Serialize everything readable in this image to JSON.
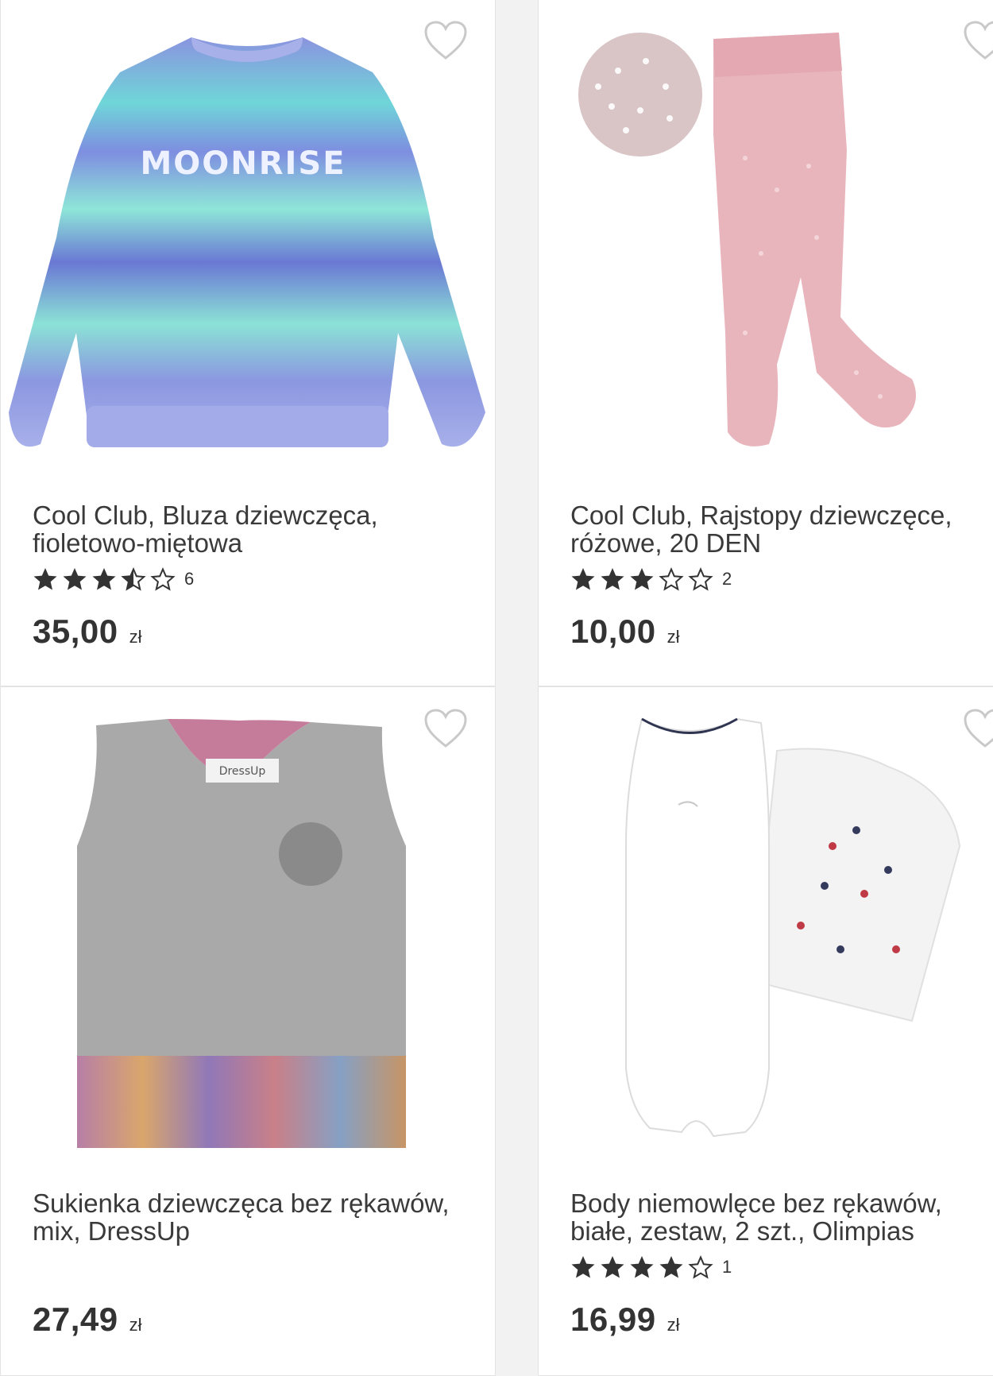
{
  "products": [
    {
      "title_line1": "Cool Club, Bluza dziewczęca,",
      "title_line2": "fioletowo-miętowa",
      "stars": 3.5,
      "rating_count": "6",
      "price": "35,00",
      "currency": "zł",
      "image_print": "MOONRISE"
    },
    {
      "title_line1": "Cool Club, Rajstopy dziewczęce,",
      "title_line2": "różowe, 20 DEN",
      "stars": 3,
      "rating_count": "2",
      "price": "10,00",
      "currency": "zł"
    },
    {
      "title_line1": "Sukienka dziewczęca bez rękawów,",
      "title_line2": "mix, DressUp",
      "price": "27,49",
      "currency": "zł",
      "image_label": "DressUp"
    },
    {
      "title_line1": "Body niemowlęce bez rękawów,",
      "title_line2": "białe, zestaw, 2 szt., Olimpias",
      "stars": 4,
      "rating_count": "1",
      "price": "16,99",
      "currency": "zł"
    }
  ],
  "icons": {
    "favorite": "heart-outline-icon",
    "star_full": "star-filled-icon",
    "star_empty": "star-outline-icon",
    "star_half": "star-half-icon"
  },
  "colors": {
    "text": "#333333",
    "star": "#333333",
    "background": "#f2f2f2",
    "card": "#ffffff"
  }
}
